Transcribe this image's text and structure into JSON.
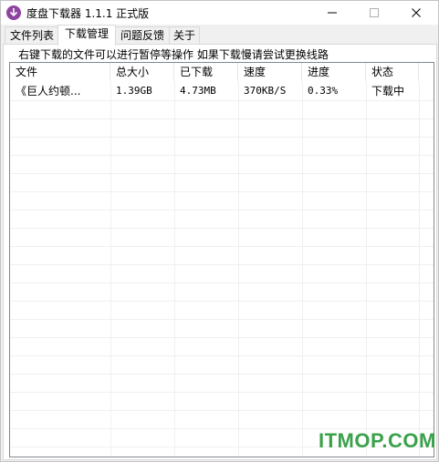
{
  "window": {
    "title": "度盘下载器 1.1.1 正式版",
    "icon": "download-arrow-icon",
    "controls": [
      "minimize-icon",
      "maximize-icon",
      "close-icon"
    ]
  },
  "tabs": [
    {
      "label": "文件列表",
      "active": false
    },
    {
      "label": "下载管理",
      "active": true
    },
    {
      "label": "问题反馈",
      "active": false
    },
    {
      "label": "关于",
      "active": false
    }
  ],
  "hint": "右键下载的文件可以进行暂停等操作  如果下载慢请尝试更换线路",
  "table": {
    "columns": [
      "文件",
      "总大小",
      "已下载",
      "速度",
      "进度",
      "状态"
    ],
    "rows": [
      [
        "《巨人约顿...",
        "1.39GB",
        "4.73MB",
        "370KB/S",
        "0.33%",
        "下载中"
      ]
    ]
  },
  "watermark": "ITMOP.COM",
  "colors": {
    "icon": "#8e44a0",
    "watermark": "#3aa14a"
  }
}
